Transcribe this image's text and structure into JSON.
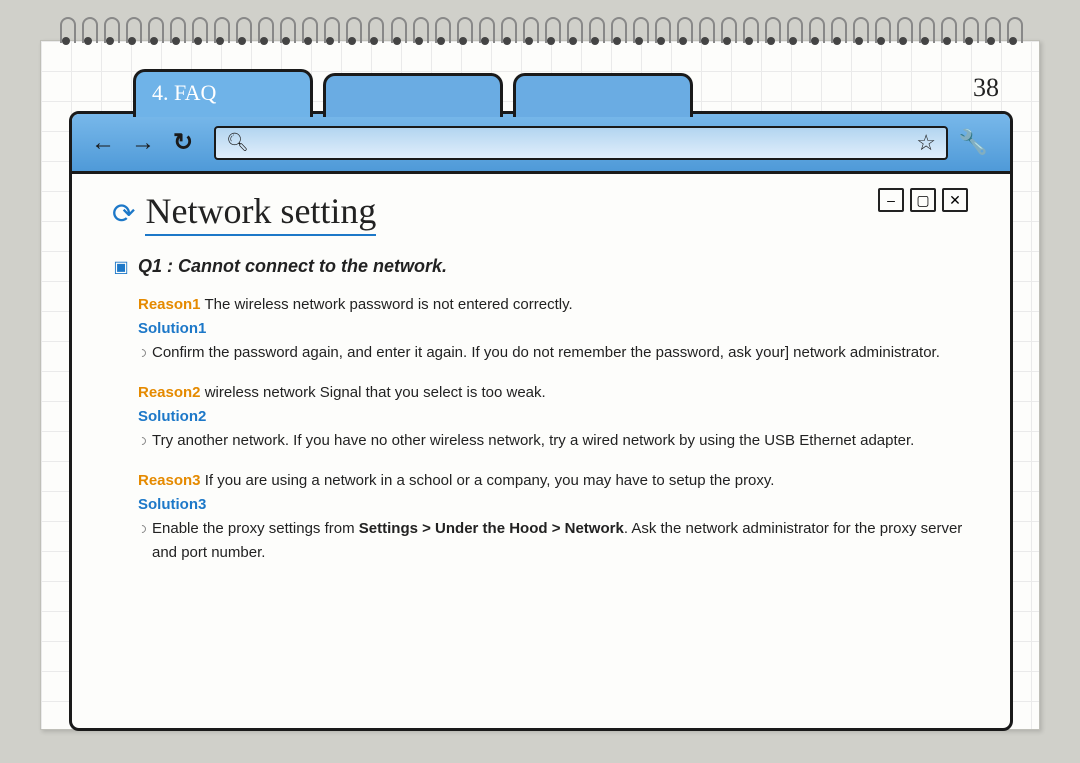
{
  "page_number": "38",
  "tab_label": "4. FAQ",
  "title": "Network setting",
  "question": "Q1 : Cannot connect to the network.",
  "items": {
    "r1_label": "Reason1",
    "r1_text": "The wireless network password is not entered correctly.",
    "s1_label": "Solution1",
    "s1_text": "Confirm the password again, and enter it again. If you do not remember the password, ask your] network administrator.",
    "r2_label": "Reason2",
    "r2_text": "wireless network Signal that you select is too weak.",
    "s2_label": "Solution2",
    "s2_text": "Try another network. If you have no other wireless network, try a wired network by using the USB Ethernet adapter.",
    "r3_label": "Reason3",
    "r3_text": "If you are using a network in a school or a company, you may have to setup the proxy.",
    "s3_label": "Solution3",
    "s3_a": "Enable the proxy settings from ",
    "s3_bold": "Settings > Under the Hood > Network",
    "s3_b": ". Ask the network administrator for the proxy server and port number."
  }
}
